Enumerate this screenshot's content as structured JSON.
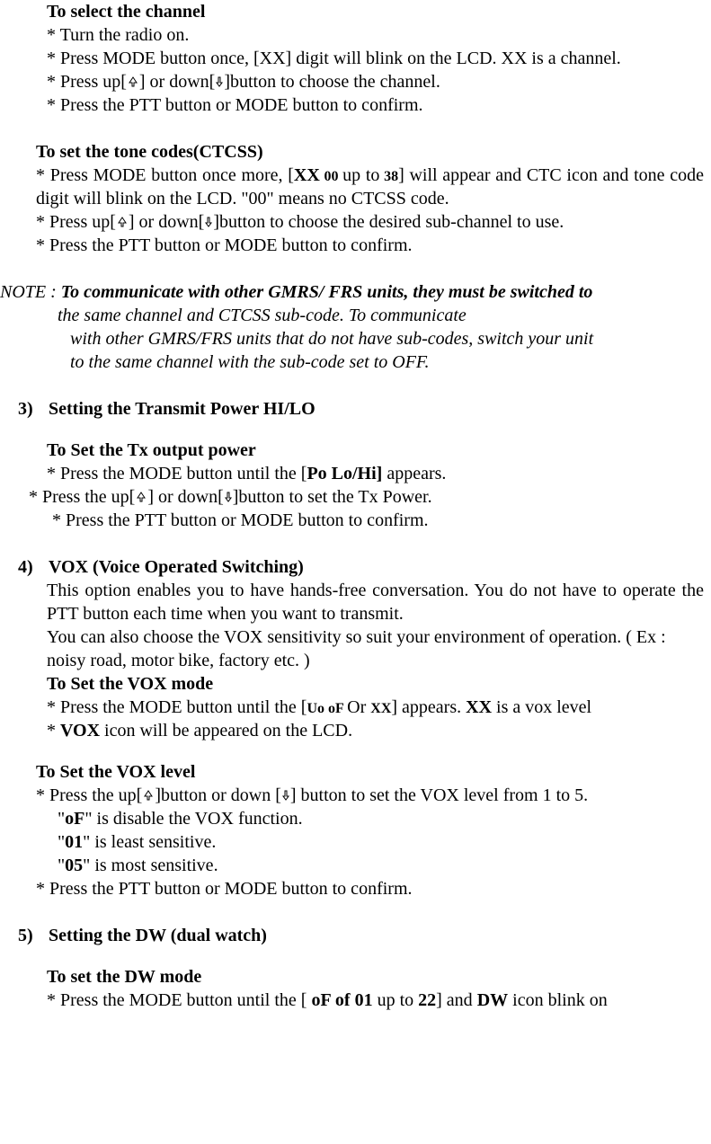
{
  "select_channel": {
    "title": "To select the channel",
    "b1": "* Turn the radio on.",
    "b2": "* Press MODE button once, [XX] digit will blink on the LCD. XX is a channel.",
    "b3a": "* Press up[",
    "b3b": "] or down[",
    "b3c": "]button to choose the channel.",
    "b4": "* Press the PTT button or MODE button to confirm."
  },
  "ctcss": {
    "title": "To set the tone codes(CTCSS)",
    "b1_a": "* Press MODE button once more, [",
    "b1_xx": "XX",
    "b1_b": " 00 ",
    "b1_c": "up to",
    "b1_d": " 38",
    "b1_e": "] will appear and CTC icon and tone code digit will blink on the LCD. \"00\" means no CTCSS code.",
    "b2_a": "* Press up[",
    "b2_b": "] or down[",
    "b2_c": "]button to choose the desired sub-channel to use.",
    "b3": "* Press the PTT button or MODE button to confirm."
  },
  "note": {
    "lead": "NOTE : ",
    "l1": "To communicate with other GMRS/ FRS units, they must be switched to",
    "l2": "the same channel and CTCSS sub-code. To communicate",
    "l3": "with other GMRS/FRS units that do not have sub-codes, switch your unit",
    "l4": "to the same channel with the sub-code set to OFF."
  },
  "s3": {
    "num": "3)",
    "title": "Setting the Transmit Power HI/LO",
    "sub": "To Set the Tx output power",
    "b1a": "* Press the MODE button until the [",
    "b1b": "Po Lo/Hi]",
    "b1c": " appears.",
    "b2a": "* Press the up[",
    "b2b": "] or down[",
    "b2c": "]button to set the Tx Power.",
    "b3": "* Press the PTT button or MODE button to confirm."
  },
  "s4": {
    "num": "4)",
    "title": "VOX (Voice Operated Switching)",
    "p1": "This option enables you to have hands-free conversation. You do not have to operate the PTT button each time when you want to transmit.",
    "p2": "You can also choose the VOX sensitivity so suit your environment of operation. ( Ex : noisy road, motor bike, factory etc. )",
    "sub1": "To Set the VOX mode",
    "b1a": "* Press the MODE button until the [",
    "b1b": "Uo oF ",
    "b1c": "Or ",
    "b1d": "XX",
    "b1e": "] appears. ",
    "b1f": "XX",
    "b1g": " is a vox level",
    "b2a": "* ",
    "b2b": "VOX",
    "b2c": " icon will be appeared on the LCD.",
    "sub2": "To Set the VOX level",
    "vl1a": "* Press the up[",
    "vl1b": "]button or down [",
    "vl1c": "] button to set the VOX level from 1 to 5.",
    "vl2a": "\"",
    "vl2b": "oF",
    "vl2c": "\" is disable the VOX function.",
    "vl3a": "\"",
    "vl3b": "01",
    "vl3c": "\" is least sensitive.",
    "vl4a": "\"",
    "vl4b": "05",
    "vl4c": "\" is most sensitive.",
    "vl5": "* Press the PTT button or MODE button to confirm."
  },
  "s5": {
    "num": "5)",
    "title": "Setting the DW (dual watch)",
    "sub": "To set the DW mode",
    "b1a": "* Press the MODE button until the [ ",
    "b1b": "oF of 01 ",
    "b1c": "up to ",
    "b1d": "22",
    "b1e": "] and ",
    "b1f": "DW",
    "b1g": " icon blink on"
  },
  "icons": {
    "up": "up",
    "down": "down"
  }
}
